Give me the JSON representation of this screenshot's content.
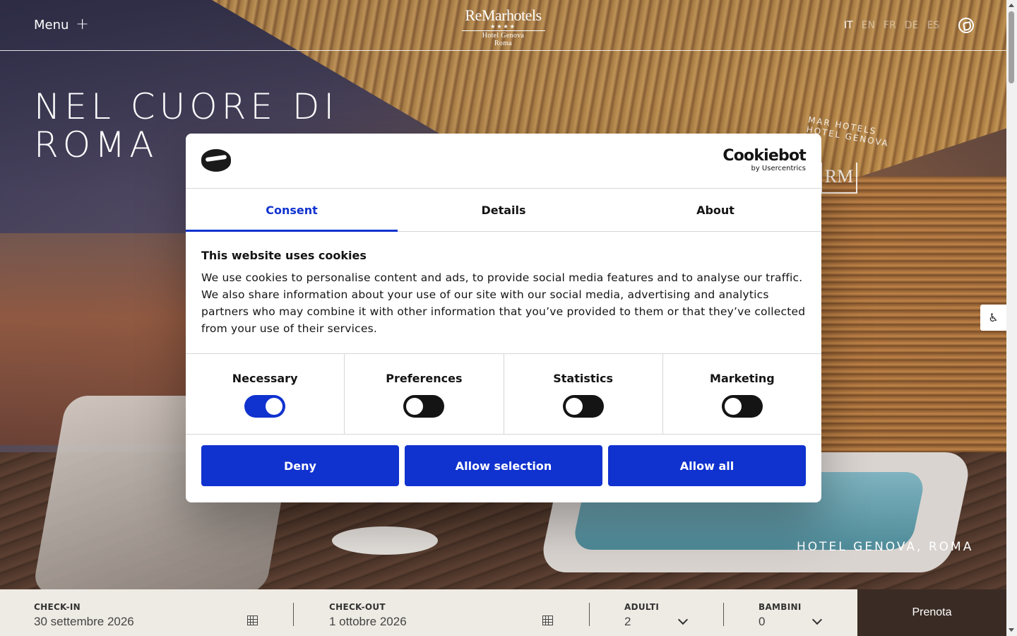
{
  "header": {
    "menu_label": "Menu",
    "logo": {
      "main": "ReMarhotels",
      "stars": "★★★★",
      "line1": "Hotel Genova",
      "line2": "Roma"
    },
    "languages": [
      {
        "code": "IT",
        "active": true
      },
      {
        "code": "EN",
        "active": false
      },
      {
        "code": "FR",
        "active": false
      },
      {
        "code": "DE",
        "active": false
      },
      {
        "code": "ES",
        "active": false
      }
    ]
  },
  "hero": {
    "title_line1": "NEL CUORE DI",
    "title_line2": "ROMA",
    "seal_text": "MAR HOTELS HOTEL GENOVA",
    "seal_monogram": "RM",
    "location": "HOTEL GENOVA, ROMA"
  },
  "booking": {
    "checkin_label": "CHECK-IN",
    "checkin_value": "30 settembre 2026",
    "checkout_label": "CHECK-OUT",
    "checkout_value": "1 ottobre 2026",
    "adults_label": "ADULTI",
    "adults_value": "2",
    "children_label": "BAMBINI",
    "children_value": "0",
    "book_label": "Prenota"
  },
  "cookie": {
    "brand_main": "Cookiebot",
    "brand_sub": "by Usercentrics",
    "tabs": [
      "Consent",
      "Details",
      "About"
    ],
    "title": "This website uses cookies",
    "text": "We use cookies to personalise content and ads, to provide social media features and to analyse our traffic. We also share information about your use of our site with our social media, advertising and analytics partners who may combine it with other information that you’ve provided to them or that they’ve collected from your use of their services.",
    "toggles": [
      {
        "label": "Necessary",
        "on": true
      },
      {
        "label": "Preferences",
        "on": false
      },
      {
        "label": "Statistics",
        "on": false
      },
      {
        "label": "Marketing",
        "on": false
      }
    ],
    "buttons": {
      "deny": "Deny",
      "allow_selection": "Allow selection",
      "allow_all": "Allow all"
    },
    "accent_color": "#1032cf"
  }
}
